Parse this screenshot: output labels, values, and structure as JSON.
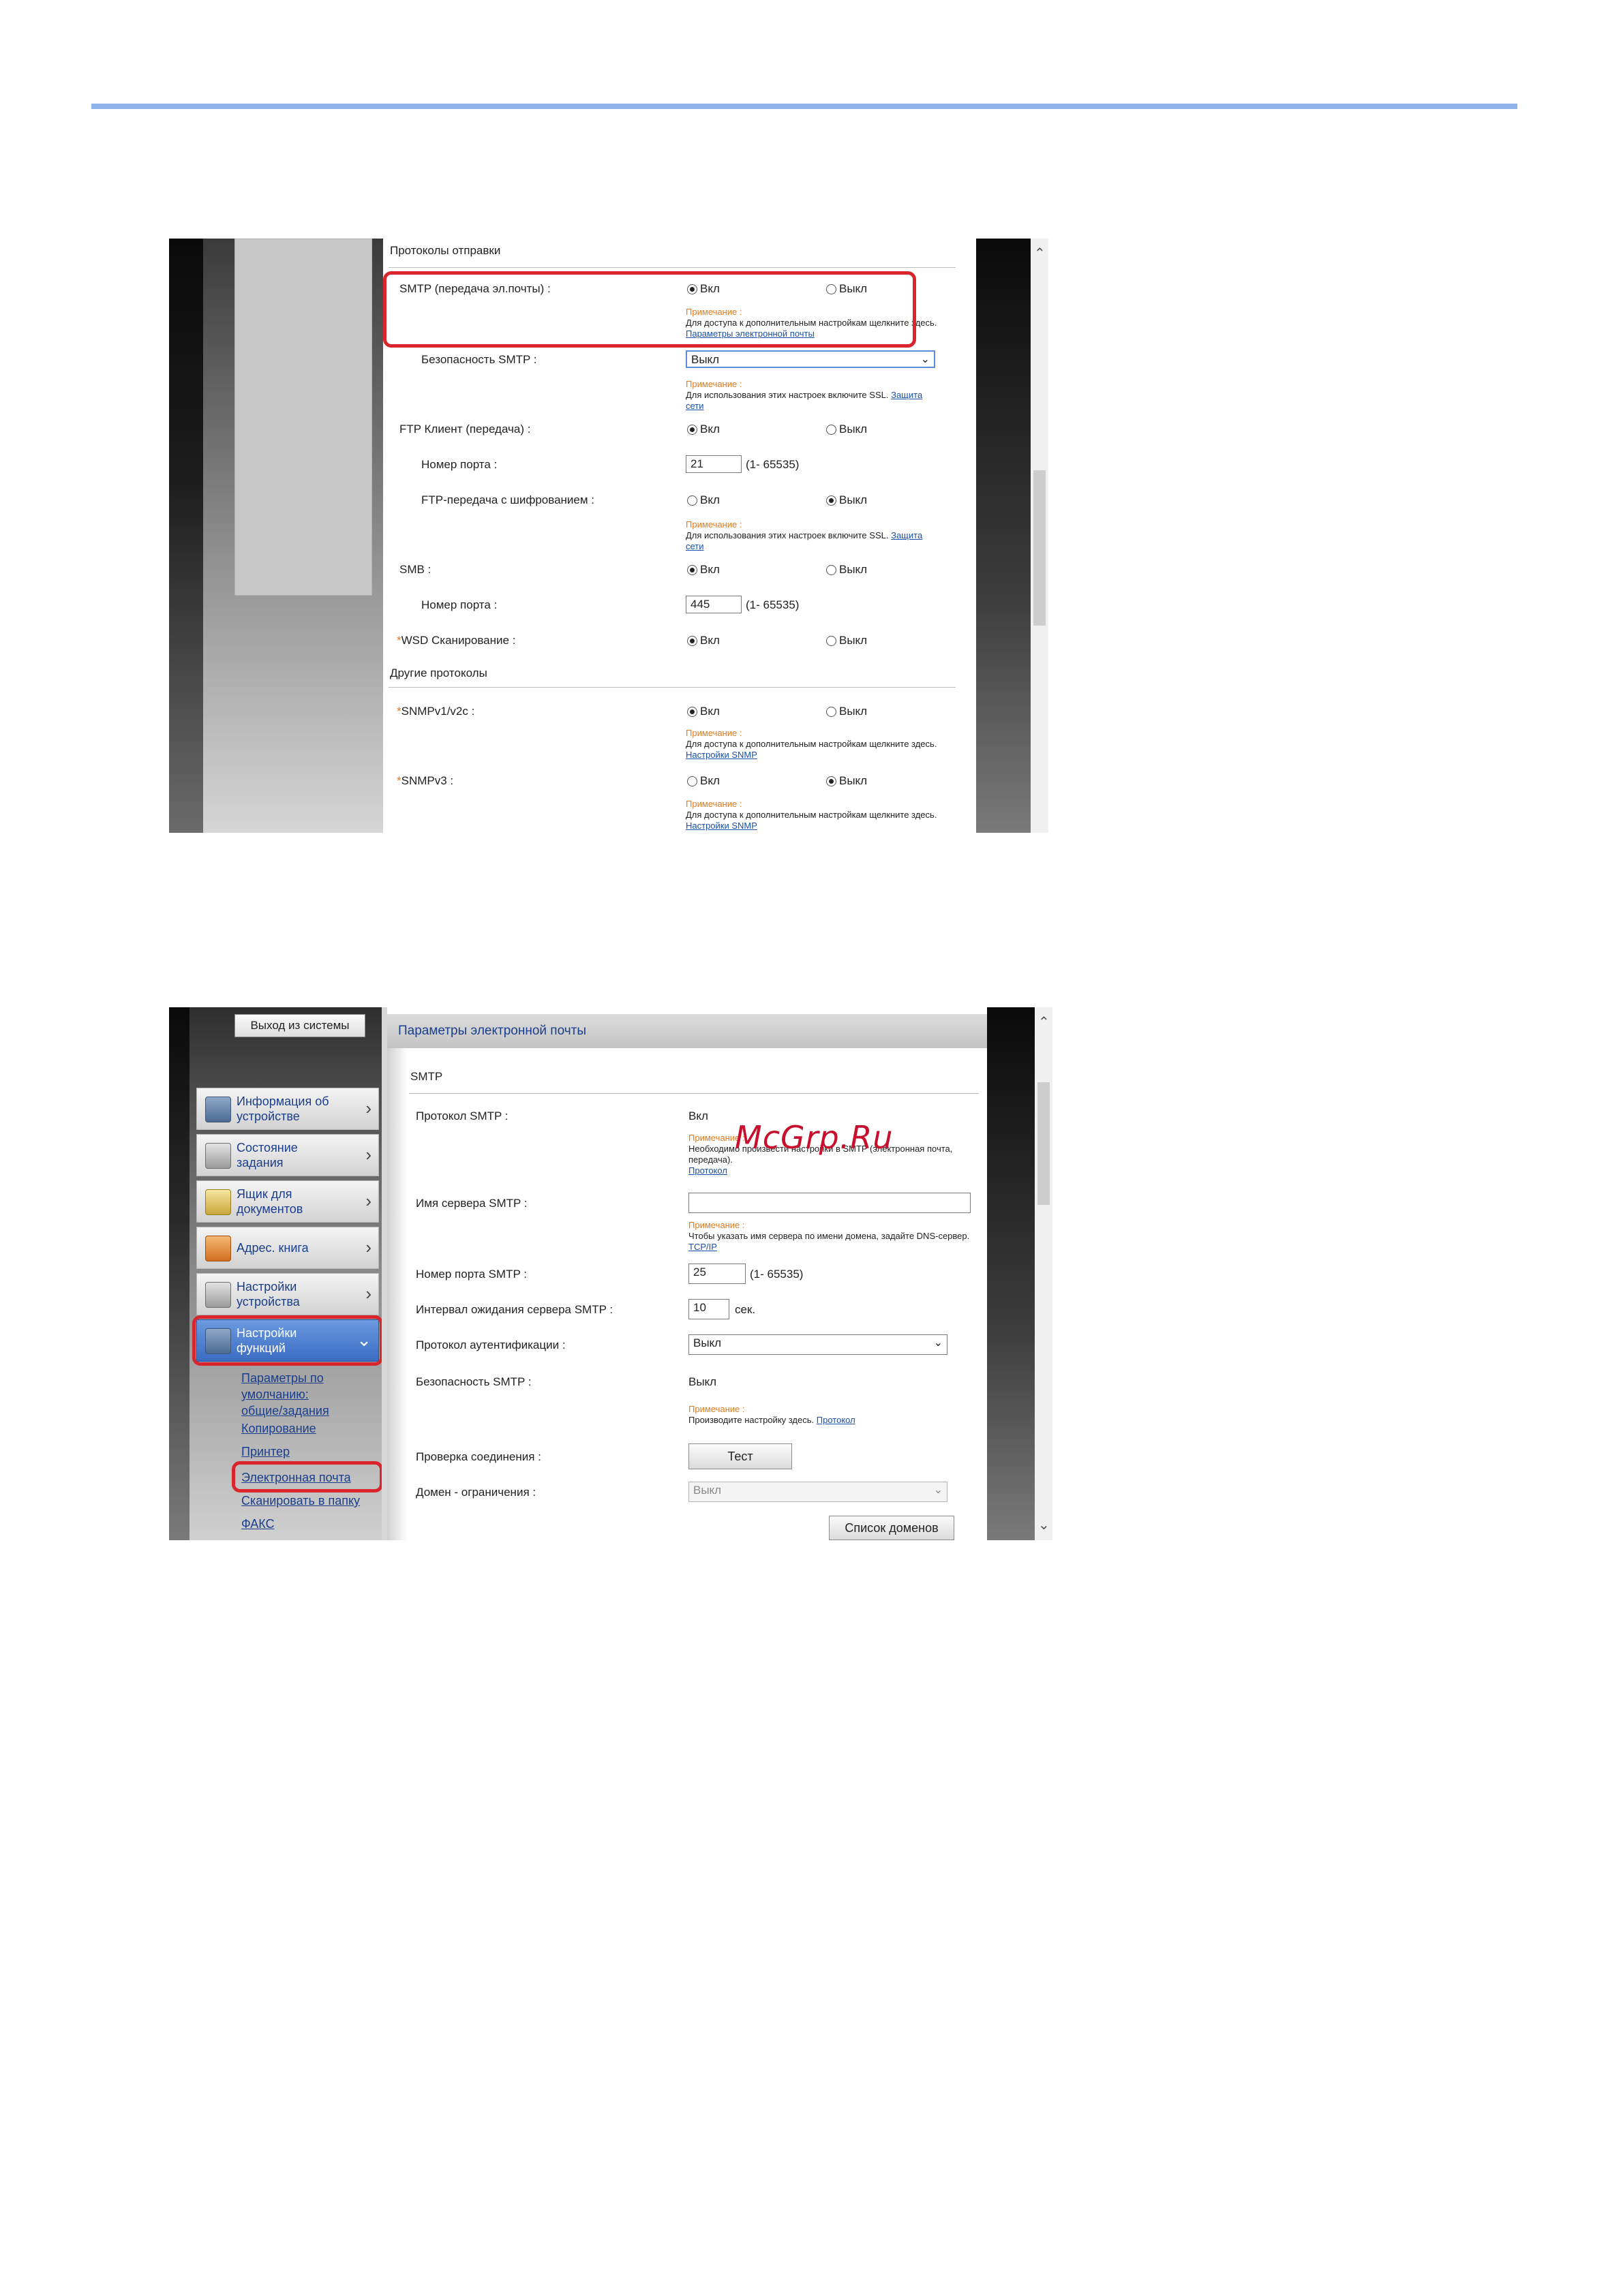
{
  "shot1": {
    "section_send": "Протоколы отправки",
    "section_other": "Другие протоколы",
    "on": "Вкл",
    "off": "Выкл",
    "note_head": "Примечание :",
    "smtp_label": "SMTP (передача эл.почты) :",
    "smtp_note": "Для доступа к дополнительным настройкам щелкните здесь.",
    "smtp_link": "Параметры электронной почты",
    "smtp_sec_label": "Безопасность SMTP :",
    "smtp_sec_value": "Выкл",
    "ssl_note": "Для использования этих настроек включите SSL.",
    "ssl_link_1": "Защита",
    "ssl_link_2": "сети",
    "ftp_label": "FTP Клиент (передача) :",
    "port_label": "Номер порта :",
    "ftp_port": "21",
    "port_range": "(1- 65535)",
    "ftp_enc_label": "FTP-передача с шифрованием :",
    "smb_label": "SMB :",
    "smb_port": "445",
    "wsd_label": "WSD Сканирование :",
    "snmpv1_label": "SNMPv1/v2c :",
    "snmp_note": "Для доступа к дополнительным настройкам щелкните здесь.",
    "snmp_link": "Настройки SNMP",
    "snmpv3_label": "SNMPv3 :",
    "star": "*"
  },
  "shot2": {
    "logout": "Выход из системы",
    "nav": {
      "info_1": "Информация об",
      "info_2": "устройстве",
      "status_1": "Состояние",
      "status_2": "задания",
      "box_1": "Ящик для",
      "box_2": "документов",
      "addr": "Адрес. книга",
      "dev_1": "Настройки",
      "dev_2": "устройства",
      "func_1": "Настройки",
      "func_2": "функций"
    },
    "sub": {
      "defaults_1": "Параметры по",
      "defaults_2": "умолчанию:",
      "defaults_3": "общие/задания",
      "copy": "Копирование",
      "printer": "Принтер",
      "email": "Электронная почта",
      "scan_folder": "Сканировать в папку",
      "fax": "ФАКС"
    },
    "header": "Параметры электронной почты",
    "section": "SMTP",
    "note_head": "Примечание :",
    "proto_label": "Протокол SMTP :",
    "proto_value": "Вкл",
    "proto_note": "Необходимо произвести настройки в SMTP (электронная почта, передача).",
    "proto_link": "Протокол",
    "server_label": "Имя сервера SMTP :",
    "server_value": "",
    "server_note": "Чтобы указать имя сервера по имени домена, задайте DNS-сервер.",
    "server_link": "TCP/IP",
    "port_label": "Номер порта SMTP :",
    "port_value": "25",
    "port_range": "(1- 65535)",
    "timeout_label": "Интервал ожидания сервера SMTP :",
    "timeout_value": "10",
    "timeout_unit": "сек.",
    "auth_label": "Протокол аутентификации :",
    "auth_value": "Выкл",
    "sec_label": "Безопасность SMTP :",
    "sec_value": "Выкл",
    "sec_note": "Производите настройку здесь.",
    "sec_link": "Протокол",
    "conn_label": "Проверка соединения :",
    "test_btn": "Тест",
    "domain_label": "Домен - ограничения :",
    "domain_value": "Выкл",
    "domain_list_btn": "Список доменов"
  },
  "watermark": "McGrp.Ru",
  "colors": {
    "accent_rule": "#8fb4ea",
    "highlight": "#d9252b",
    "note_orange": "#e07a1c",
    "link_blue": "#1a4fa8"
  }
}
